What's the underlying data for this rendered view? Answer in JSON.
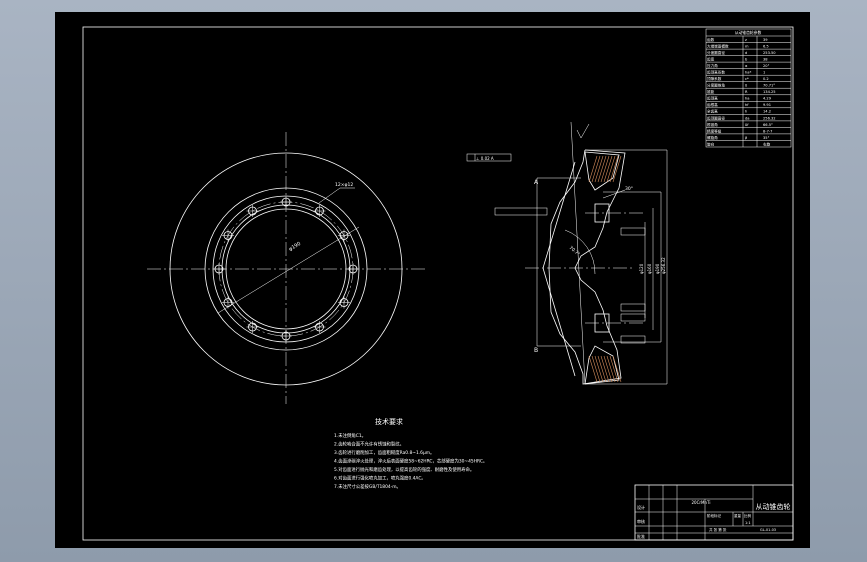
{
  "drawing": {
    "notes": {
      "heading": "技术要求",
      "items": [
        "1.未注倒角C1。",
        "2.齿轮啮合面不允许有锈蚀和裂纹。",
        "3.齿轮进行磨削加工，齿面粗糙度Ra0.8~1.6μm。",
        "4.齿面渗碳淬火处理，淬火后表面硬度58~62HRC，芯部硬度为30~45HRC。",
        "5.对齿面进行抛光和磨齿处理，以提高齿轮的强度、耐磨性及使用寿命。",
        "6.对齿面进行强化喷丸加工，喷丸强度0.4AC。",
        "7.未注尺寸公差按GB/T1804-m。"
      ]
    },
    "parameter_table": {
      "title": "从动锥齿轮参数",
      "rows": [
        [
          "齿数",
          "z",
          "39"
        ],
        [
          "大端端面模数",
          "m",
          "6.5"
        ],
        [
          "分度圆直径",
          "d",
          "253.50"
        ],
        [
          "齿宽",
          "b",
          "38"
        ],
        [
          "压力角",
          "α",
          "20°"
        ],
        [
          "齿顶高系数",
          "ha*",
          "1"
        ],
        [
          "顶隙系数",
          "c*",
          "0.2"
        ],
        [
          "分度圆锥角",
          "δ",
          "70.71°"
        ],
        [
          "锥距",
          "R",
          "134.25"
        ],
        [
          "齿顶高",
          "ha",
          "4.29"
        ],
        [
          "齿根高",
          "hf",
          "9.91"
        ],
        [
          "全齿高",
          "h",
          "14.2"
        ],
        [
          "齿顶圆直径",
          "da",
          "256.32"
        ],
        [
          "根锥角",
          "δf",
          "66.5°"
        ],
        [
          "精度等级",
          "",
          "8-7-7"
        ],
        [
          "螺旋角",
          "β",
          "35°"
        ],
        [
          "旋向",
          "",
          "右旋"
        ]
      ]
    },
    "title_block": {
      "drawing_title": "从动锥齿轮",
      "material": "20CrMnTi",
      "scale": "1:1",
      "row_labels": [
        "设计",
        "审核",
        "批准"
      ],
      "stage_labels": [
        "阶段标记",
        "重量",
        "比例"
      ],
      "drawing_number": "GL-01-03",
      "sheet_info": "共 张 第 张"
    },
    "dimensions": {
      "bolt_circle": "φ190",
      "bolt_holes": "12×φ12",
      "section_labels": [
        "A",
        "B"
      ],
      "datum_frame": "⊥ 0.02 A",
      "chamfer": "30°",
      "angle": "70.7°",
      "diameters": [
        "φ256.32",
        "φ190",
        "φ160",
        "φ120"
      ]
    }
  }
}
